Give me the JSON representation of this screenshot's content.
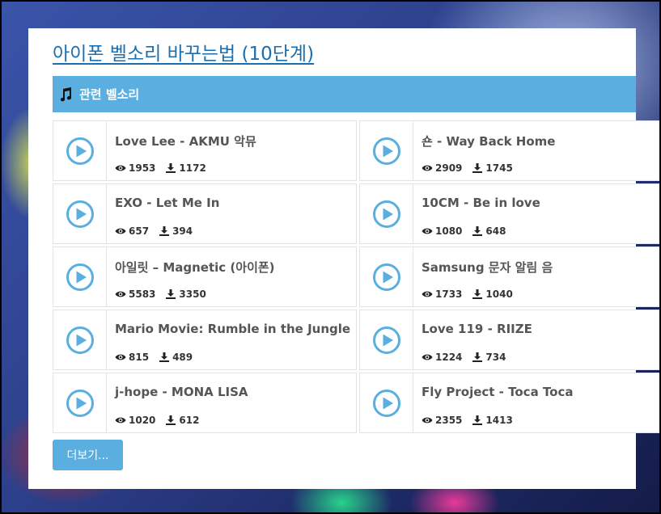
{
  "page": {
    "title": "아이폰 벨소리 바꾸는법 (10단계)"
  },
  "section": {
    "label": "관련 벨소리"
  },
  "songs": [
    {
      "title": "Love Lee - AKMU 악뮤",
      "views": "1953",
      "downloads": "1172"
    },
    {
      "title": "숀 - Way Back Home",
      "views": "2909",
      "downloads": "1745"
    },
    {
      "title": "EXO - Let Me In",
      "views": "657",
      "downloads": "394"
    },
    {
      "title": "10CM - Be in love",
      "views": "1080",
      "downloads": "648"
    },
    {
      "title": "아일릿 – Magnetic (아이폰)",
      "views": "5583",
      "downloads": "3350"
    },
    {
      "title": "Samsung 문자 알림 음",
      "views": "1733",
      "downloads": "1040"
    },
    {
      "title": "Mario Movie: Rumble in the Jungle",
      "views": "815",
      "downloads": "489"
    },
    {
      "title": "Love 119 - RIIZE",
      "views": "1224",
      "downloads": "734"
    },
    {
      "title": "j-hope - MONA LISA",
      "views": "1020",
      "downloads": "612"
    },
    {
      "title": "Fly Project - Toca Toca",
      "views": "2355",
      "downloads": "1413"
    }
  ],
  "more_button": {
    "label": "더보기..."
  },
  "colors": {
    "accent": "#5aaee0",
    "title_link": "#1a6fb0"
  }
}
